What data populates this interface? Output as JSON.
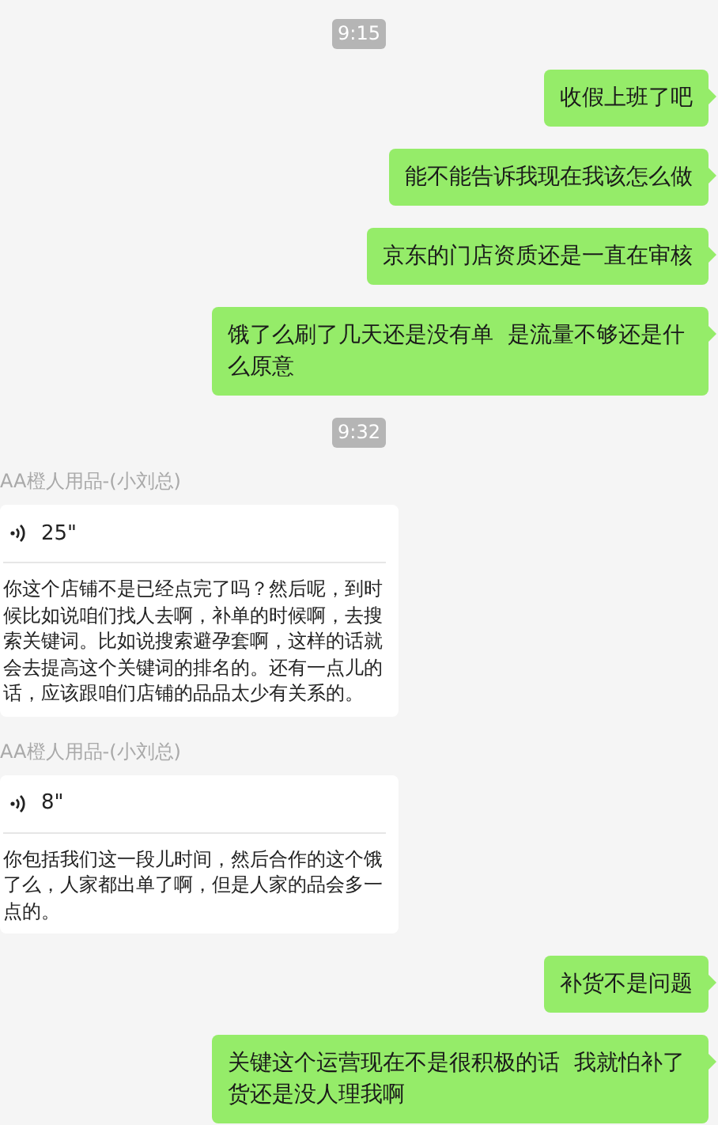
{
  "messages": [
    {
      "kind": "time",
      "text": "9:15"
    },
    {
      "kind": "sent",
      "text": "收假上班了吧"
    },
    {
      "kind": "sent",
      "text": "能不能告诉我现在我该怎么做"
    },
    {
      "kind": "sent",
      "text": "京东的门店资质还是一直在审核"
    },
    {
      "kind": "sent",
      "text": "饿了么刷了几天还是没有单  是流量不够还是什么原意"
    },
    {
      "kind": "time",
      "text": "9:32"
    },
    {
      "kind": "received",
      "sender": "AA橙人用品-(小刘总)",
      "duration": "25\"",
      "text": "你这个店铺不是已经点完了吗？然后呢，到时候比如说咱们找人去啊，补单的时候啊，去搜索关键词。比如说搜索避孕套啊，这样的话就会去提高这个关键词的排名的。还有一点儿的话，应该跟咱们店铺的品品太少有关系的。"
    },
    {
      "kind": "received",
      "sender": "AA橙人用品-(小刘总)",
      "duration": "8\"",
      "text": "你包括我们这一段儿时间，然后合作的这个饿了么，人家都出单了啊，但是人家的品会多一点的。"
    },
    {
      "kind": "sent",
      "text": "补货不是问题"
    },
    {
      "kind": "sent",
      "text": "关键这个运营现在不是很积极的话  我就怕补了货还是没人理我啊"
    }
  ]
}
